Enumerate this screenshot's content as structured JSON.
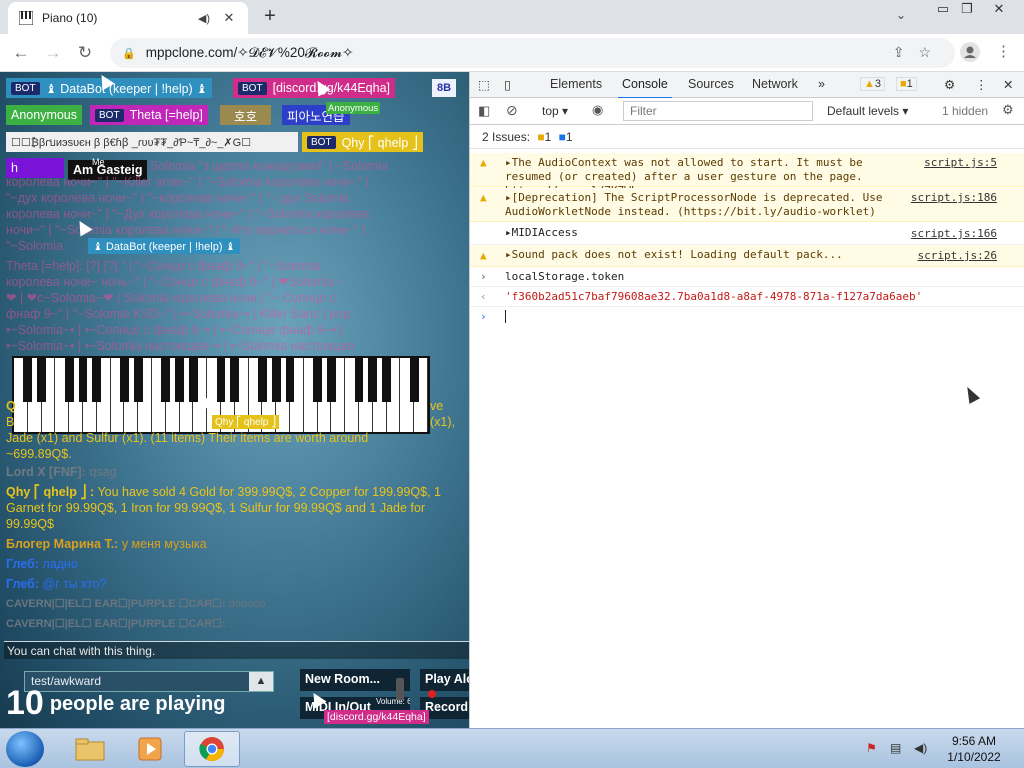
{
  "browser": {
    "tab_title": "Piano (10)",
    "url": "mppclone.com/✧𝓓𝓔𝓥%20𝓡𝓸𝓸𝓶✧"
  },
  "piano": {
    "badges": [
      {
        "bot": "BOT",
        "text": "♝ DataBot (keeper | !help) ♝",
        "color": "#2f8fbf"
      },
      {
        "bot": "BOT",
        "text": "[discord.gg/k44Eqha]",
        "color": "#d02c8a"
      },
      {
        "bot": "",
        "text": "Anonymous",
        "color": "#3cb043"
      },
      {
        "bot": "BOT",
        "text": "Theta [=help]",
        "color": "#c026b8"
      },
      {
        "bot": "",
        "text": "호호",
        "color": "#9a8a50"
      },
      {
        "bot": "",
        "text": "피아노연습",
        "color": "#2d3fc8"
      },
      {
        "bot": "",
        "text": "☐☐₿βɾบиэѕυєн β β€ɦꞵ _ɾʋʋ₮₮_∂Ƥ~₸_∂~_✗G☐",
        "color": "#f0f0f0"
      },
      {
        "bot": "BOT",
        "text": "Qhy ⎡ qhelp ⎦",
        "color": "#e4c21a"
      },
      {
        "bot": "",
        "text": "h",
        "color": "#7a14d8"
      },
      {
        "bot": "",
        "text": "Am Gasteig",
        "color": "#111111"
      }
    ],
    "anon_tag": "Anonymous",
    "me_tag": "Me",
    "bb_button": "8B",
    "databot_tag": "♝ DataBot (keeper | !help) ♝",
    "qhy_tag": "Qhy ⎡ qhelp ⎦",
    "discord_tag": "[discord.gg/k44Eqha]",
    "faded_lines": [
      "Solomia \"з щелпэ конхшуэвиэ\" | ~Solomia",
      "королева ночи~\" | \"~Killer anne~\" | \"~Solomia королева ночи~\" |",
      "\"~дух королева ночи~\" | \"~королева ночи~\" | \"~ дух Solomia",
      "королева ночи~\" | \"~Дух королева ночи~\" | \"~Solomia королева",
      "ночи~\" | \"~Solomia королева ночи~\" | \"~Кто вернёться ночи~\" |",
      "\"~Solomia",
      "Theta [=help]: [?]  [?] \" | \"~Сонце с фнаф 9~\" | \"~Solomia",
      "королева ночи~ ночь~\" | \"~Сонце с фнаф 9~\" | ❤Solomia ~",
      "❤ | ❤c~Solomia~❤ | Solomia королева ночи | \"~ Солнце с",
      "фнаф 9~\" | \"~Solomia KSD~\" | •~Solomia~• | Killer Sans | pnp",
      "•~Solomia~• | •~Солнце с фнаф 9~• | •~Солнце фнаф 9~• |",
      "•~Solomia~• | •~Solomia настоящая~• | •~Solomia настоящая"
    ],
    "hidden_line_1": "Q",
    "hidden_line_2": "ve",
    "hidden_line_3": "B",
    "hidden_line_4": "(x1),",
    "hidden_line_5": "Jade (x1) and Sulfur (x1). (11 items) Their items are worth around",
    "hidden_line_6": "~699.89Q$.",
    "chat": [
      {
        "name": "Lord X [FNF]:",
        "text": " qsag",
        "name_color": "#707880",
        "text_color": "#707880"
      },
      {
        "name": "Qhy ⎡ qhelp ⎦ :",
        "text": " You have sold 4 Gold for 399.99Q$, 2 Copper for 199.99Q$, 1 Garnet for 99.99Q$, 1 Iron for 99.99Q$, 1 Sulfur for 99.99Q$ and 1 Jade for 99.99Q$",
        "name_color": "#e8c41c",
        "text_color": "#e8c41c"
      },
      {
        "name": "Блогер Марина Т.:",
        "text": " у меня музыка",
        "name_color": "#d8a020",
        "text_color": "#d8a020"
      },
      {
        "name": "Глеб:",
        "text": " ладно",
        "name_color": "#2a6ef0",
        "text_color": "#2a6ef0"
      },
      {
        "name": "Глеб:",
        "text": " @г ты кто?",
        "name_color": "#2a6ef0",
        "text_color": "#2a6ef0"
      },
      {
        "name": "CAVERN|☐|EL☐ EAR☐|PURPLE ☐CAR☐:",
        "text": " dooooo",
        "name_color": "#6b7580",
        "text_color": "#6b7580"
      },
      {
        "name": "CAVERN|☐|EL☐ EAR☐|PURPLE ☐CAR☐:",
        "text": " .",
        "name_color": "#6b7580",
        "text_color": "#6b7580"
      }
    ],
    "you_can_chat": "You can chat with this thing.",
    "chat_input_value": "test/awkward",
    "people_count": "10",
    "people_text": "people are playing",
    "buttons": {
      "new_room": "New Room...",
      "play_alone": "Play Alo",
      "midi": "MIDI In/Out",
      "volume": "Volume: 6",
      "record": "Record"
    }
  },
  "devtools": {
    "tabs": [
      "Elements",
      "Console",
      "Sources",
      "Network"
    ],
    "active_tab": "Console",
    "more": "»",
    "warn_count": "3",
    "issue_count": "1",
    "context": "top",
    "filter_placeholder": "Filter",
    "levels": "Default levels",
    "hidden": "1 hidden",
    "issues_label": "2 Issues:",
    "issues_warn": "1",
    "issues_info": "1",
    "messages": [
      {
        "kind": "warn",
        "text": "The AudioContext was not allowed to start. It must be resumed (or created) after a user gesture on the page. https://goo.gl/7K7WLu",
        "src": "script.js:5"
      },
      {
        "kind": "warn",
        "text": "[Deprecation] The ScriptProcessorNode is deprecated. Use AudioWorkletNode instead. (https://bit.ly/audio-worklet)",
        "src": "script.js:186"
      },
      {
        "kind": "log",
        "text": "MIDIAccess",
        "src": "script.js:166"
      },
      {
        "kind": "warn",
        "text": "Sound pack does not exist! Loading default pack...",
        "src": "script.js:26"
      }
    ],
    "input_cmd": "localStorage.token",
    "result": "'f360b2ad51c7baf79608ae32.7ba0a1d8-a8af-4978-871a-f127a7da6aeb'"
  },
  "taskbar": {
    "time": "9:56 AM",
    "date": "1/10/2022"
  }
}
